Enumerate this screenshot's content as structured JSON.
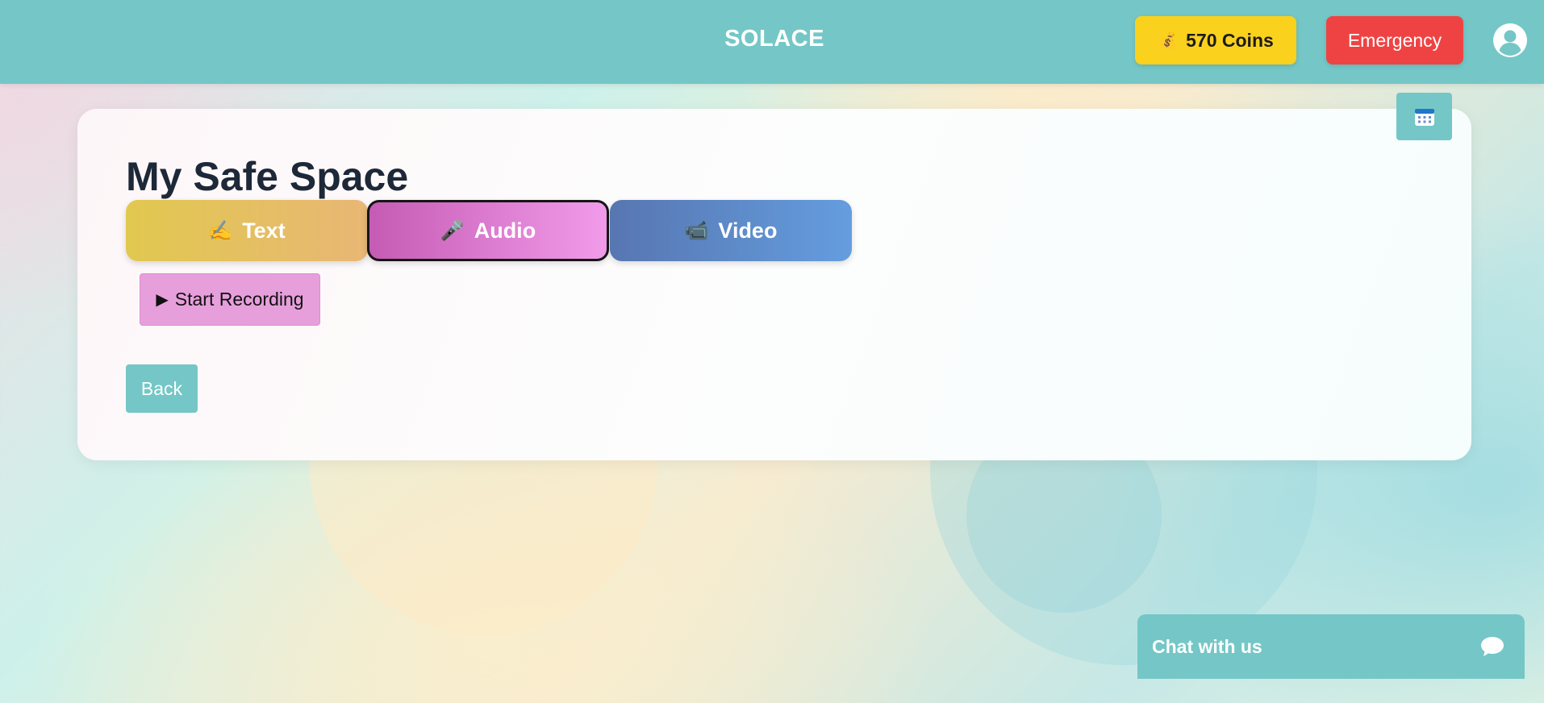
{
  "header": {
    "brand": "SOLACE",
    "coins_label": "570 Coins",
    "coins_icon": "money-bag-icon",
    "coins_emoji": "💰",
    "emergency_label": "Emergency",
    "profile_icon": "user-avatar-icon"
  },
  "card": {
    "calendar_icon": "calendar-icon",
    "title": "My Safe Space",
    "modes": [
      {
        "label": "Text",
        "emoji": "✍️",
        "icon": "writing-hand-icon"
      },
      {
        "label": "Audio",
        "emoji": "🎤",
        "icon": "microphone-icon",
        "selected": true
      },
      {
        "label": "Video",
        "emoji": "📹",
        "icon": "video-camera-icon"
      }
    ],
    "record_label": "Start Recording",
    "record_icon_glyph": "▶",
    "back_label": "Back"
  },
  "chat": {
    "label": "Chat with us",
    "icon": "chat-bubble-icon"
  },
  "colors": {
    "header_bg": "#74c7c6",
    "coins_bg": "#fad11d",
    "emergency_bg": "#ef4343",
    "audio_border": "#151515",
    "record_bg": "#e79fdc"
  }
}
